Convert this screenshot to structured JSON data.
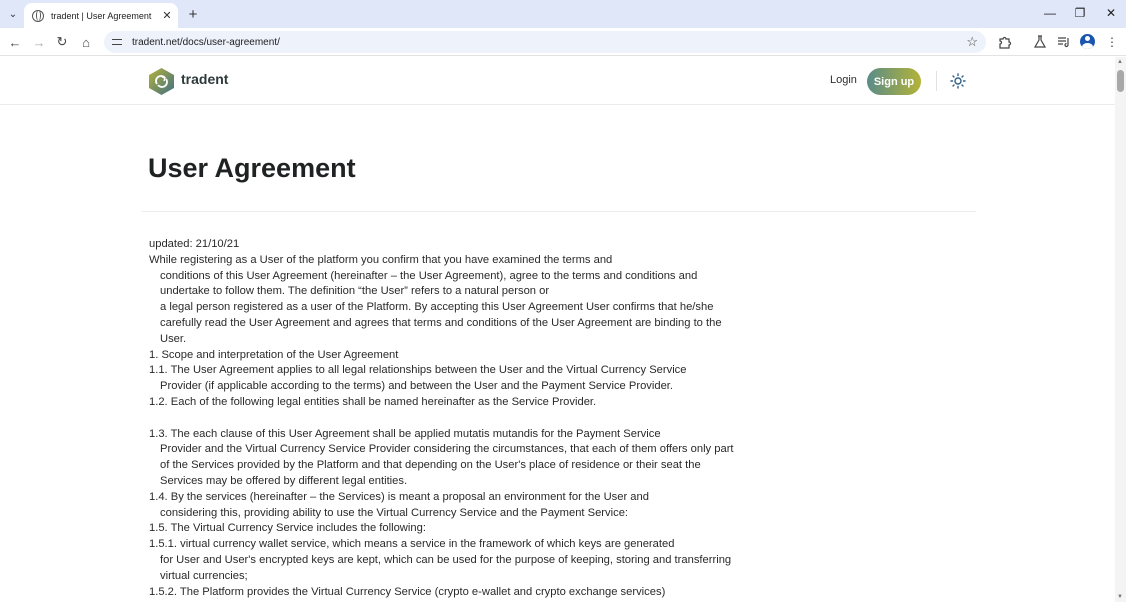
{
  "browser": {
    "tab_title": "tradent | User Agreement",
    "url": "tradent.net/docs/user-agreement/",
    "icons": {
      "tab_dropdown": "chevron-down-icon",
      "new_tab": "plus-icon",
      "back": "arrow-left-icon",
      "forward": "arrow-right-icon",
      "reload": "reload-icon",
      "home": "home-icon",
      "site_info": "tune-icon",
      "bookmark": "star-icon",
      "extensions": "puzzle-icon",
      "labs": "flask-icon",
      "media": "media-queue-icon",
      "profile": "profile-icon",
      "menu": "kebab-menu-icon"
    }
  },
  "site": {
    "brand": "tradent",
    "login_label": "Login",
    "signup_label": "Sign up",
    "accent_colors": [
      "#5a8c88",
      "#b4b338"
    ]
  },
  "page": {
    "title": "User Agreement",
    "lines": [
      {
        "text": "updated: 21/10/21",
        "indent": false
      },
      {
        "text": "While registering as a User of the platform you confirm that you have examined the terms and",
        "indent": false
      },
      {
        "text": "conditions of this User Agreement (hereinafter – the User Agreement), agree to the terms and conditions and",
        "indent": true
      },
      {
        "text": "undertake to follow them. The definition “the User” refers to a natural person or",
        "indent": true
      },
      {
        "text": "a legal person registered as a user of the Platform. By accepting this User Agreement User confirms that he/she",
        "indent": true
      },
      {
        "text": "carefully read the User Agreement and agrees that terms and conditions of the User Agreement are binding to the",
        "indent": true
      },
      {
        "text": "User.",
        "indent": true
      },
      {
        "text": "1. Scope and interpretation of the User Agreement",
        "indent": false
      },
      {
        "text": "1.1. The User Agreement applies to all legal relationships between the User and the Virtual Currency Service",
        "indent": false
      },
      {
        "text": "Provider (if applicable according to the terms) and between the User and the Payment Service Provider.",
        "indent": true
      },
      {
        "text": "1.2. Each of the following legal entities shall be named hereinafter as the Service Provider.",
        "indent": false
      },
      {
        "text": "",
        "indent": false
      },
      {
        "text": "1.3. The each clause of this User Agreement shall be applied mutatis mutandis for the Payment Service",
        "indent": false
      },
      {
        "text": "Provider and the Virtual Currency Service Provider considering the circumstances, that each of them offers only part",
        "indent": true
      },
      {
        "text": "of the Services provided by the Platform and that depending on the User's place of residence or their seat the",
        "indent": true
      },
      {
        "text": "Services may be offered by different legal entities.",
        "indent": true
      },
      {
        "text": "1.4. By the services (hereinafter – the Services) is meant a proposal an environment for the User and",
        "indent": false
      },
      {
        "text": "considering this, providing ability to use the Virtual Currency Service and the Payment Service:",
        "indent": true
      },
      {
        "text": "1.5. The Virtual Currency Service includes the following:",
        "indent": false
      },
      {
        "text": "1.5.1. virtual currency wallet service, which means a service in the framework of which keys are generated",
        "indent": false
      },
      {
        "text": "for User and User's encrypted keys are kept, which can be used for the purpose of keeping, storing and transferring",
        "indent": true
      },
      {
        "text": "virtual currencies;",
        "indent": true
      },
      {
        "text": "1.5.2. The Platform provides the Virtual Currency Service (crypto e-wallet and crypto exchange services)",
        "indent": false
      }
    ]
  }
}
